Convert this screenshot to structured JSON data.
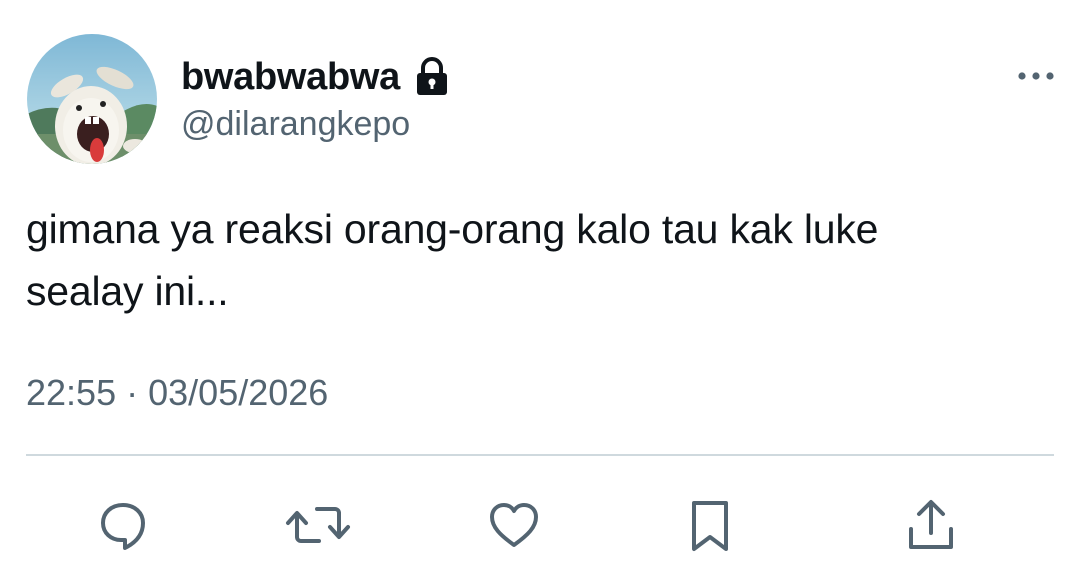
{
  "user": {
    "display_name": "bwabwabwa",
    "handle": "@dilarangkepo",
    "protected_icon": "lock-icon",
    "avatar": "rabbid-avatar"
  },
  "tweet": {
    "text": "gimana ya reaksi orang-orang kalo tau kak luke\nsealay ini...",
    "time": "22:55",
    "separator": "·",
    "date": "03/05/2026"
  },
  "actions": [
    {
      "name": "reply",
      "icon": "reply-icon"
    },
    {
      "name": "retweet",
      "icon": "retweet-icon"
    },
    {
      "name": "like",
      "icon": "heart-icon"
    },
    {
      "name": "bookmark",
      "icon": "bookmark-icon"
    },
    {
      "name": "share",
      "icon": "share-icon"
    }
  ],
  "colors": {
    "text_primary": "#0f1419",
    "text_secondary": "#536471",
    "divider": "#cfd9de"
  }
}
